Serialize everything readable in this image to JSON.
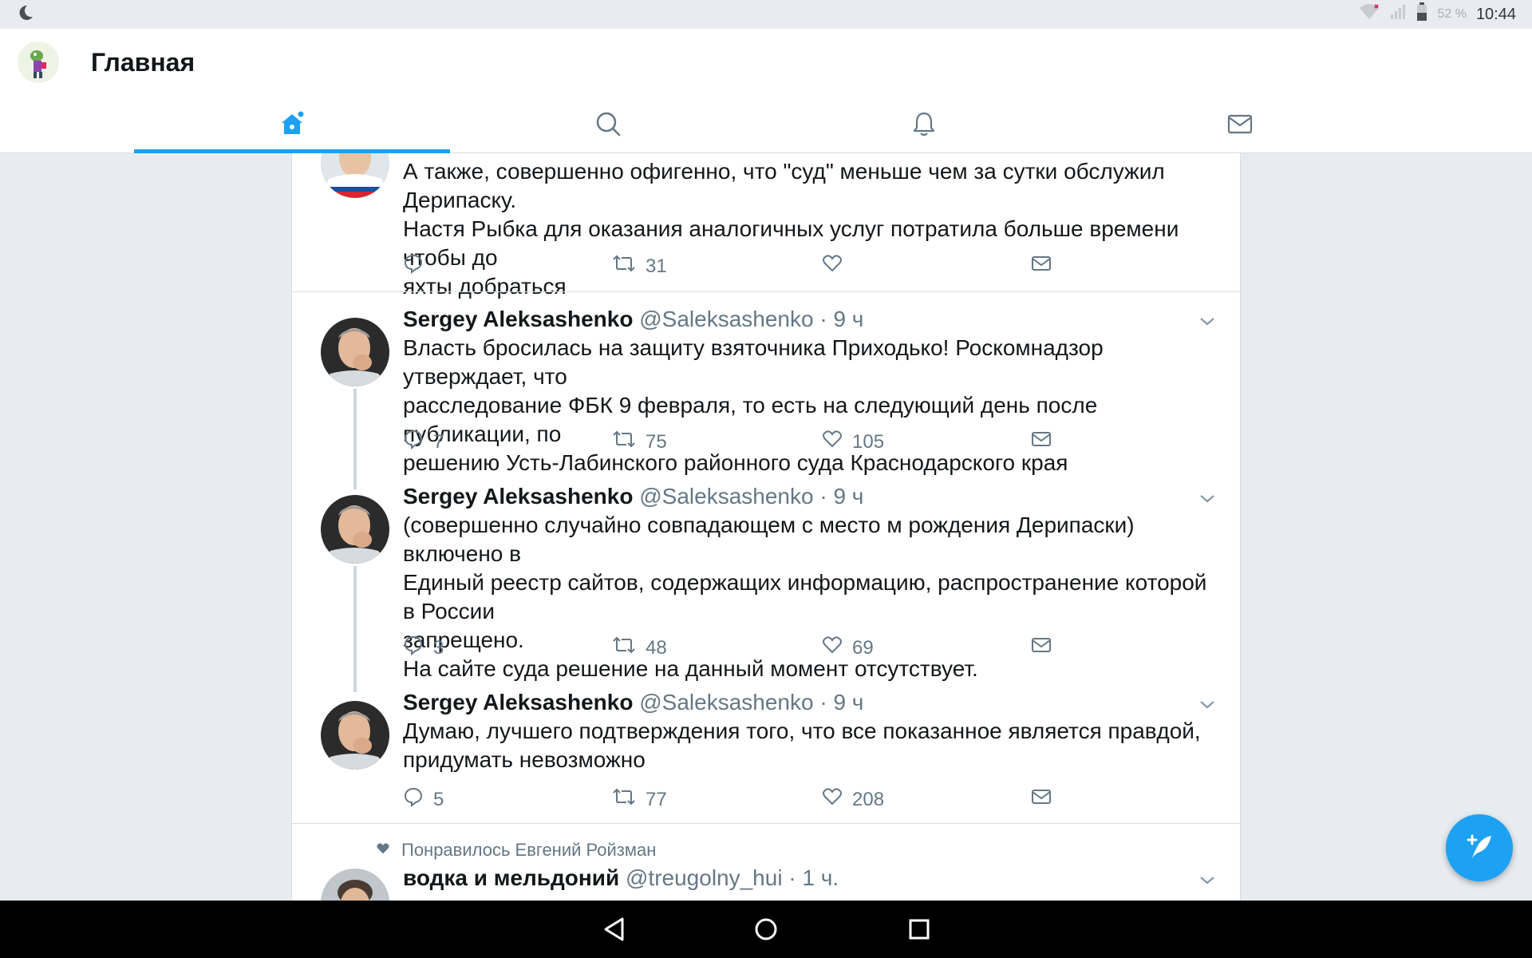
{
  "status": {
    "battery_pct": "52 %",
    "time": "10:44"
  },
  "header": {
    "title": "Главная"
  },
  "tabs": [
    {
      "name": "home",
      "icon": "home-icon",
      "active": true
    },
    {
      "name": "search",
      "icon": "search-icon",
      "active": false
    },
    {
      "name": "notifications",
      "icon": "bell-icon",
      "active": false
    },
    {
      "name": "messages",
      "icon": "envelope-icon",
      "active": false
    }
  ],
  "tweets": [
    {
      "text": [
        "А также, совершенно офигенно, что \"суд\" меньше чем за сутки обслужил Дерипаску.",
        "Настя Рыбка для оказания аналогичных услуг потратила больше времени чтобы до",
        "яхты добраться"
      ],
      "reply_count": "",
      "retweet_count": "31",
      "like_count": ""
    },
    {
      "name": "Sergey Aleksashenko",
      "handle": "@Saleksashenko",
      "time": "9 ч",
      "text": [
        "Власть бросилась на защиту взяточника Приходько! Роскомнадзор утверждает, что",
        "расследование ФБК 9 февраля, то есть на следующий день после публикации, по",
        "решению Усть-Лабинского районного суда Краснодарского края"
      ],
      "reply_count": "7",
      "retweet_count": "75",
      "like_count": "105"
    },
    {
      "name": "Sergey Aleksashenko",
      "handle": "@Saleksashenko",
      "time": "9 ч",
      "text": [
        "(совершенно случайно совпадающем с место м рождения Дерипаски) включено в",
        "Единый реестр сайтов, содержащих информацию, распространение которой в России",
        "запрещено.",
        "На сайте суда решение на данный момент отсутствует."
      ],
      "reply_count": "3",
      "retweet_count": "48",
      "like_count": "69"
    },
    {
      "name": "Sergey Aleksashenko",
      "handle": "@Saleksashenko",
      "time": "9 ч",
      "text": [
        "Думаю, лучшего подтверждения того, что все показанное является правдой,",
        "придумать невозможно"
      ],
      "reply_count": "5",
      "retweet_count": "77",
      "like_count": "208"
    },
    {
      "social_context": "Понравилось Евгений Ройзман",
      "name": "водка и мельдоний",
      "handle": "@treugolny_hui",
      "time": "1 ч."
    }
  ],
  "colors": {
    "accent": "#1da1f2",
    "muted": "#657786",
    "background": "#e6ecf0"
  }
}
